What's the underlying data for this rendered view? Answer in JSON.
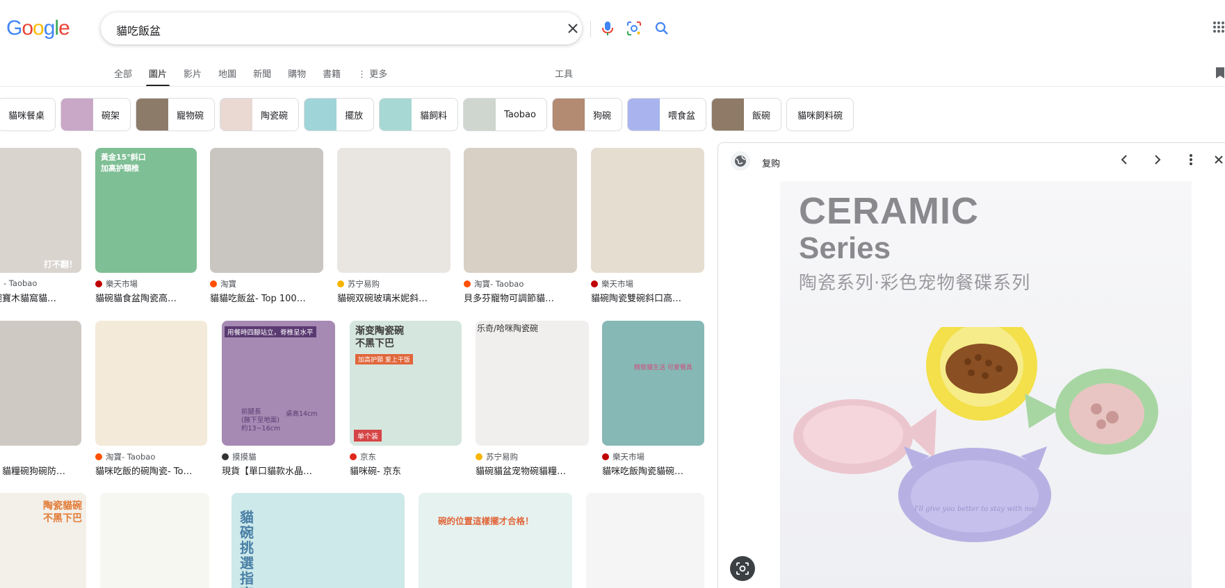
{
  "brand": {
    "logo_letters": [
      {
        "ch": "G",
        "color": "#4285F4"
      },
      {
        "ch": "o",
        "color": "#EA4335"
      },
      {
        "ch": "o",
        "color": "#FBBC05"
      },
      {
        "ch": "g",
        "color": "#4285F4"
      },
      {
        "ch": "l",
        "color": "#34A853"
      },
      {
        "ch": "e",
        "color": "#EA4335"
      }
    ]
  },
  "search": {
    "query": "貓吃飯盆",
    "clear_icon": "close-icon",
    "voice_icon": "microphone-icon",
    "lens_icon": "camera-lens-icon",
    "submit_icon": "search-icon"
  },
  "tabs": [
    {
      "label": "全部",
      "active": false
    },
    {
      "label": "圖片",
      "active": true
    },
    {
      "label": "影片",
      "active": false
    },
    {
      "label": "地圖",
      "active": false
    },
    {
      "label": "新聞",
      "active": false
    },
    {
      "label": "購物",
      "active": false
    },
    {
      "label": "書籍",
      "active": false
    },
    {
      "label": "⋮ 更多",
      "active": false
    }
  ],
  "tools_label": "工具",
  "chips": [
    {
      "label": "貓咪餐桌",
      "has_thumb": false,
      "thumb": "#f2efe9"
    },
    {
      "label": "碗架",
      "has_thumb": true,
      "thumb": "#c9a7c6"
    },
    {
      "label": "寵物碗",
      "has_thumb": true,
      "thumb": "#8d7b6a"
    },
    {
      "label": "陶瓷碗",
      "has_thumb": true,
      "thumb": "#e9d9d2"
    },
    {
      "label": "擺放",
      "has_thumb": true,
      "thumb": "#9fd4d8"
    },
    {
      "label": "貓飼料",
      "has_thumb": true,
      "thumb": "#a8d8d4"
    },
    {
      "label": "Taobao",
      "has_thumb": true,
      "thumb": "#cfd6cf"
    },
    {
      "label": "狗碗",
      "has_thumb": true,
      "thumb": "#b38a72"
    },
    {
      "label": "喂食盆",
      "has_thumb": true,
      "thumb": "#a9b4ee"
    },
    {
      "label": "飯碗",
      "has_thumb": true,
      "thumb": "#8e7a66"
    },
    {
      "label": "貓咪飼料碗",
      "has_thumb": false,
      "thumb": "#ffffff"
    }
  ],
  "results_row1": [
    {
      "source": "- Taobao",
      "title": "碗寶木貓窩貓…",
      "fav": "#ff5000",
      "img": "#d9d4ce"
    },
    {
      "source": "樂天市場",
      "title": "貓碗貓食盆陶瓷高…",
      "fav": "#bf0000",
      "img": "#7fbf95"
    },
    {
      "source": "淘寶",
      "title": "貓貓吃飯盆- Top 100…",
      "fav": "#ff5000",
      "img": "#c9c5c0"
    },
    {
      "source": "苏宁易购",
      "title": "貓碗双碗玻璃米妮斜…",
      "fav": "#f7b500",
      "img": "#e9e6e2"
    },
    {
      "source": "淘寶- Taobao",
      "title": "貝多芬寵物可調節貓…",
      "fav": "#ff5000",
      "img": "#d8cfc5"
    },
    {
      "source": "樂天市場",
      "title": "貓碗陶瓷雙碗斜口高…",
      "fav": "#bf0000",
      "img": "#e6ddd1"
    }
  ],
  "results_row2": [
    {
      "source": "",
      "title": "】貓糧碗狗碗防…",
      "fav": "#bf0000",
      "img": "#cfc9c3"
    },
    {
      "source": "淘寶- Taobao",
      "title": "貓咪吃飯的碗陶瓷- To…",
      "fav": "#ff5000",
      "img": "#f4ead9"
    },
    {
      "source": "摸摸貓",
      "title": "現貨【單口貓款水晶…",
      "fav": "#333333",
      "img": "#a68ab3"
    },
    {
      "source": "京东",
      "title": "貓咪碗- 京东",
      "fav": "#e1251b",
      "img": "#d5e6de"
    },
    {
      "source": "苏宁易购",
      "title": "貓碗貓盆宠物碗貓糧…",
      "fav": "#f7b500",
      "img": "#f1eeee"
    },
    {
      "source": "樂天市場",
      "title": "貓咪吃飯陶瓷貓碗…",
      "fav": "#bf0000",
      "img": "#86b8b5"
    }
  ],
  "results_row3": [
    {
      "overlay": "陶瓷貓碗\n不黑下巴",
      "img": "#f3efe9"
    },
    {
      "overlay": "",
      "img": "#f7f7f2"
    },
    {
      "overlay": "貓碗挑選指南",
      "img": "#cde9ea"
    },
    {
      "overlay": "碗的位置這樣擺才合格！",
      "img": "#e6f2ef"
    },
    {
      "overlay": "",
      "img": "#f5f5f5"
    }
  ],
  "overlays": {
    "r1c2": "黃金15°斜口\n加高护頸椎",
    "r1c1": "打不翻！",
    "r2c3": "用餐時四腳站立，脊椎呈水平",
    "r2c3b": "前腿長\n(腋下至地面)\n約13~16cm",
    "r2c3c": "桌高14cm",
    "r2c4": "渐变陶瓷碗\n不黑下巴",
    "r2c4b": "加高护頸 爱上干饭",
    "r2c4c": "单个装",
    "r2c5": "乐奇/哈咪陶瓷碗",
    "r2c6": "精致貓生活 可爱餐具"
  },
  "panel": {
    "site_name": "复购",
    "globe_icon": "globe-icon",
    "prev_icon": "chevron-left-icon",
    "next_icon": "chevron-right-icon",
    "more_icon": "more-vert-icon",
    "close_icon": "close-icon",
    "preview": {
      "headline": "CERAMIC",
      "subhead": "Series",
      "caption": "陶瓷系列·彩色宠物餐碟系列",
      "bowl_text": "I'll give you better\nto stay with me"
    }
  },
  "colors": {
    "accent_blue": "#1a73e8",
    "text_secondary": "#5f6368",
    "border": "#dadce0"
  }
}
